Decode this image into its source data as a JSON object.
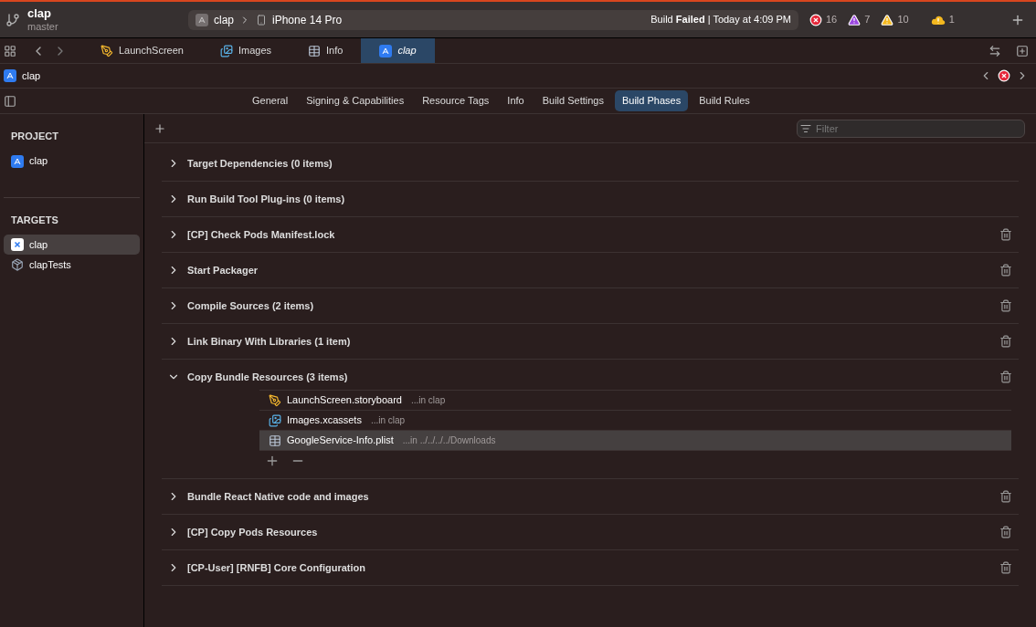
{
  "scheme": {
    "project": "clap",
    "branch": "master"
  },
  "toolbar": {
    "scheme": "clap",
    "device": "iPhone 14 Pro",
    "status": "Build **Failed** | Today at 4:09 PM",
    "issues": [
      {
        "kind": "error",
        "count": "16"
      },
      {
        "kind": "runtime",
        "count": "7"
      },
      {
        "kind": "warning",
        "count": "10"
      },
      {
        "kind": "cloud",
        "count": "1"
      }
    ]
  },
  "editor_tabs": [
    {
      "label": "LaunchScreen",
      "kind": "storyboard",
      "selected": false,
      "preview": false
    },
    {
      "label": "Images",
      "kind": "assets",
      "selected": false,
      "preview": false
    },
    {
      "label": "Info",
      "kind": "plist",
      "selected": false,
      "preview": false
    },
    {
      "label": "clap",
      "kind": "project",
      "selected": true,
      "preview": true
    }
  ],
  "breadcrumb": {
    "label": "clap"
  },
  "settings_tabs": [
    {
      "label": "General",
      "selected": false
    },
    {
      "label": "Signing & Capabilities",
      "selected": false
    },
    {
      "label": "Resource Tags",
      "selected": false
    },
    {
      "label": "Info",
      "selected": false
    },
    {
      "label": "Build Settings",
      "selected": false
    },
    {
      "label": "Build Phases",
      "selected": true
    },
    {
      "label": "Build Rules",
      "selected": false
    }
  ],
  "sidebar": {
    "sections": [
      {
        "title": "PROJECT",
        "items": [
          {
            "label": "clap",
            "kind": "project",
            "selected": false
          }
        ]
      },
      {
        "title": "TARGETS",
        "items": [
          {
            "label": "clap",
            "kind": "app",
            "selected": true
          },
          {
            "label": "clapTests",
            "kind": "tests",
            "selected": false
          }
        ]
      }
    ]
  },
  "filter": {
    "placeholder": "Filter"
  },
  "phases": [
    {
      "title": "Target Dependencies (0 items)",
      "expanded": false,
      "deletable": false
    },
    {
      "title": "Run Build Tool Plug-ins (0 items)",
      "expanded": false,
      "deletable": false
    },
    {
      "title": "[CP] Check Pods Manifest.lock",
      "expanded": false,
      "deletable": true
    },
    {
      "title": "Start Packager",
      "expanded": false,
      "deletable": true
    },
    {
      "title": "Compile Sources (2 items)",
      "expanded": false,
      "deletable": true
    },
    {
      "title": "Link Binary With Libraries (1 item)",
      "expanded": false,
      "deletable": true
    },
    {
      "title": "Copy Bundle Resources (3 items)",
      "expanded": true,
      "deletable": true,
      "files": [
        {
          "name": "LaunchScreen.storyboard",
          "location": "...in clap",
          "kind": "storyboard",
          "selected": false
        },
        {
          "name": "Images.xcassets",
          "location": "...in clap",
          "kind": "assets",
          "selected": false
        },
        {
          "name": "GoogleService-Info.plist",
          "location": "...in ../../../../Downloads",
          "kind": "plist",
          "selected": true
        }
      ]
    },
    {
      "title": "Bundle React Native code and images",
      "expanded": false,
      "deletable": true
    },
    {
      "title": "[CP] Copy Pods Resources",
      "expanded": false,
      "deletable": true
    },
    {
      "title": "[CP-User] [RNFB] Core Configuration",
      "expanded": false,
      "deletable": true
    }
  ]
}
